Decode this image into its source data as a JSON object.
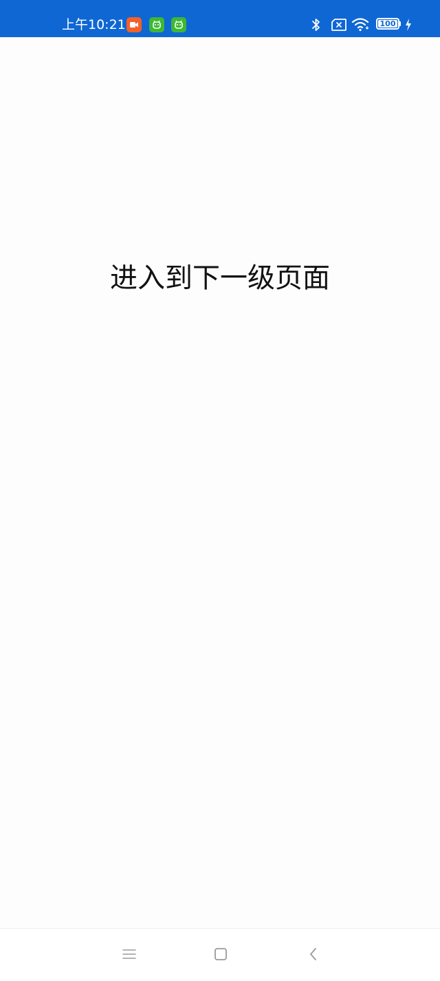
{
  "status_bar": {
    "time": "上午10:21",
    "battery_level": "100",
    "notification_icons": [
      "video-app-icon",
      "android-app-icon",
      "android-app-icon"
    ],
    "system_icons": [
      "bluetooth-icon",
      "no-sim-icon",
      "wifi-icon",
      "battery-icon",
      "charging-icon"
    ],
    "colors": {
      "background": "#0f67d4",
      "video_app": "#f2612a",
      "android_app": "#3db834"
    }
  },
  "main": {
    "link_text": "进入到下一级页面"
  },
  "nav_bar": {
    "buttons": [
      "menu-icon",
      "home-icon",
      "back-icon"
    ]
  }
}
